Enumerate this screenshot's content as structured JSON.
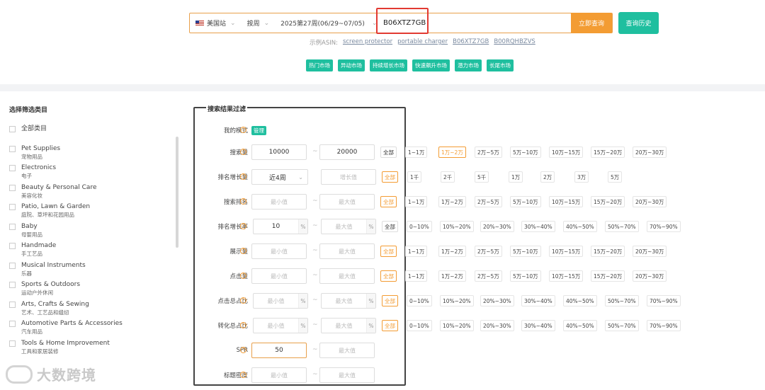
{
  "search": {
    "marketplace": "美国站",
    "period_type": "按周",
    "week": "2025第27周(06/29~07/05)",
    "asin": "B06XTZ7GB",
    "submit_label": "立即查询",
    "history_label": "查询历史",
    "examples_label": "示例ASIN:",
    "examples": [
      "screen protector",
      "portable charger",
      "B06XTZ7GB",
      "B00RQHBZVS"
    ]
  },
  "market_tags": [
    "热门市场",
    "异动市场",
    "持续增长市场",
    "快速飙升市场",
    "潜力市场",
    "长尾市场"
  ],
  "sidebar": {
    "title": "选择筛选类目",
    "categories": [
      {
        "en": "全部类目",
        "cn": ""
      },
      {
        "en": "Pet Supplies",
        "cn": "宠物用品"
      },
      {
        "en": "Electronics",
        "cn": "电子"
      },
      {
        "en": "Beauty & Personal Care",
        "cn": "美容化妆"
      },
      {
        "en": "Patio, Lawn & Garden",
        "cn": "庭院、草坪和花园用品"
      },
      {
        "en": "Baby",
        "cn": "母婴用品"
      },
      {
        "en": "Handmade",
        "cn": "手工艺品"
      },
      {
        "en": "Musical Instruments",
        "cn": "乐器"
      },
      {
        "en": "Sports & Outdoors",
        "cn": "运动户外休闲"
      },
      {
        "en": "Arts, Crafts & Sewing",
        "cn": "艺术、工艺品和缝纫"
      },
      {
        "en": "Automotive Parts & Accessories",
        "cn": "汽车用品"
      },
      {
        "en": "Tools & Home Improvement",
        "cn": "工具和家居装修"
      }
    ]
  },
  "filters": {
    "title": "搜索结果过滤",
    "my_mode_label": "我的模式",
    "manage_label": "管理",
    "all_label": "全部",
    "min_placeholder": "最小值",
    "max_placeholder": "最大值",
    "growth_placeholder": "增长值",
    "pct": "%",
    "rows": {
      "search_volume": {
        "label": "搜索量",
        "min": "10000",
        "max": "20000"
      },
      "rank_growth": {
        "label": "排名增长量",
        "select": "近4周"
      },
      "search_rank": {
        "label": "搜索排名"
      },
      "rank_growth_rate": {
        "label": "排名增长率",
        "min": "10"
      },
      "impressions": {
        "label": "展示量"
      },
      "clicks": {
        "label": "点击量"
      },
      "click_share": {
        "label": "点击总占比"
      },
      "conversion_share": {
        "label": "转化总占比"
      },
      "spr": {
        "label": "SPR",
        "min": "50"
      },
      "title_density": {
        "label": "标题密度"
      }
    },
    "ranges_volume": [
      "1~1万",
      "1万~2万",
      "2万~5万",
      "5万~10万",
      "10万~15万",
      "15万~20万",
      "20万~30万"
    ],
    "ranges_growth": [
      "1千",
      "2千",
      "5千",
      "1万",
      "2万",
      "3万",
      "5万"
    ],
    "ranges_pct": [
      "0~10%",
      "10%~20%",
      "20%~30%",
      "30%~40%",
      "40%~50%",
      "50%~70%",
      "70%~90%"
    ]
  },
  "watermark": "大数跨境"
}
